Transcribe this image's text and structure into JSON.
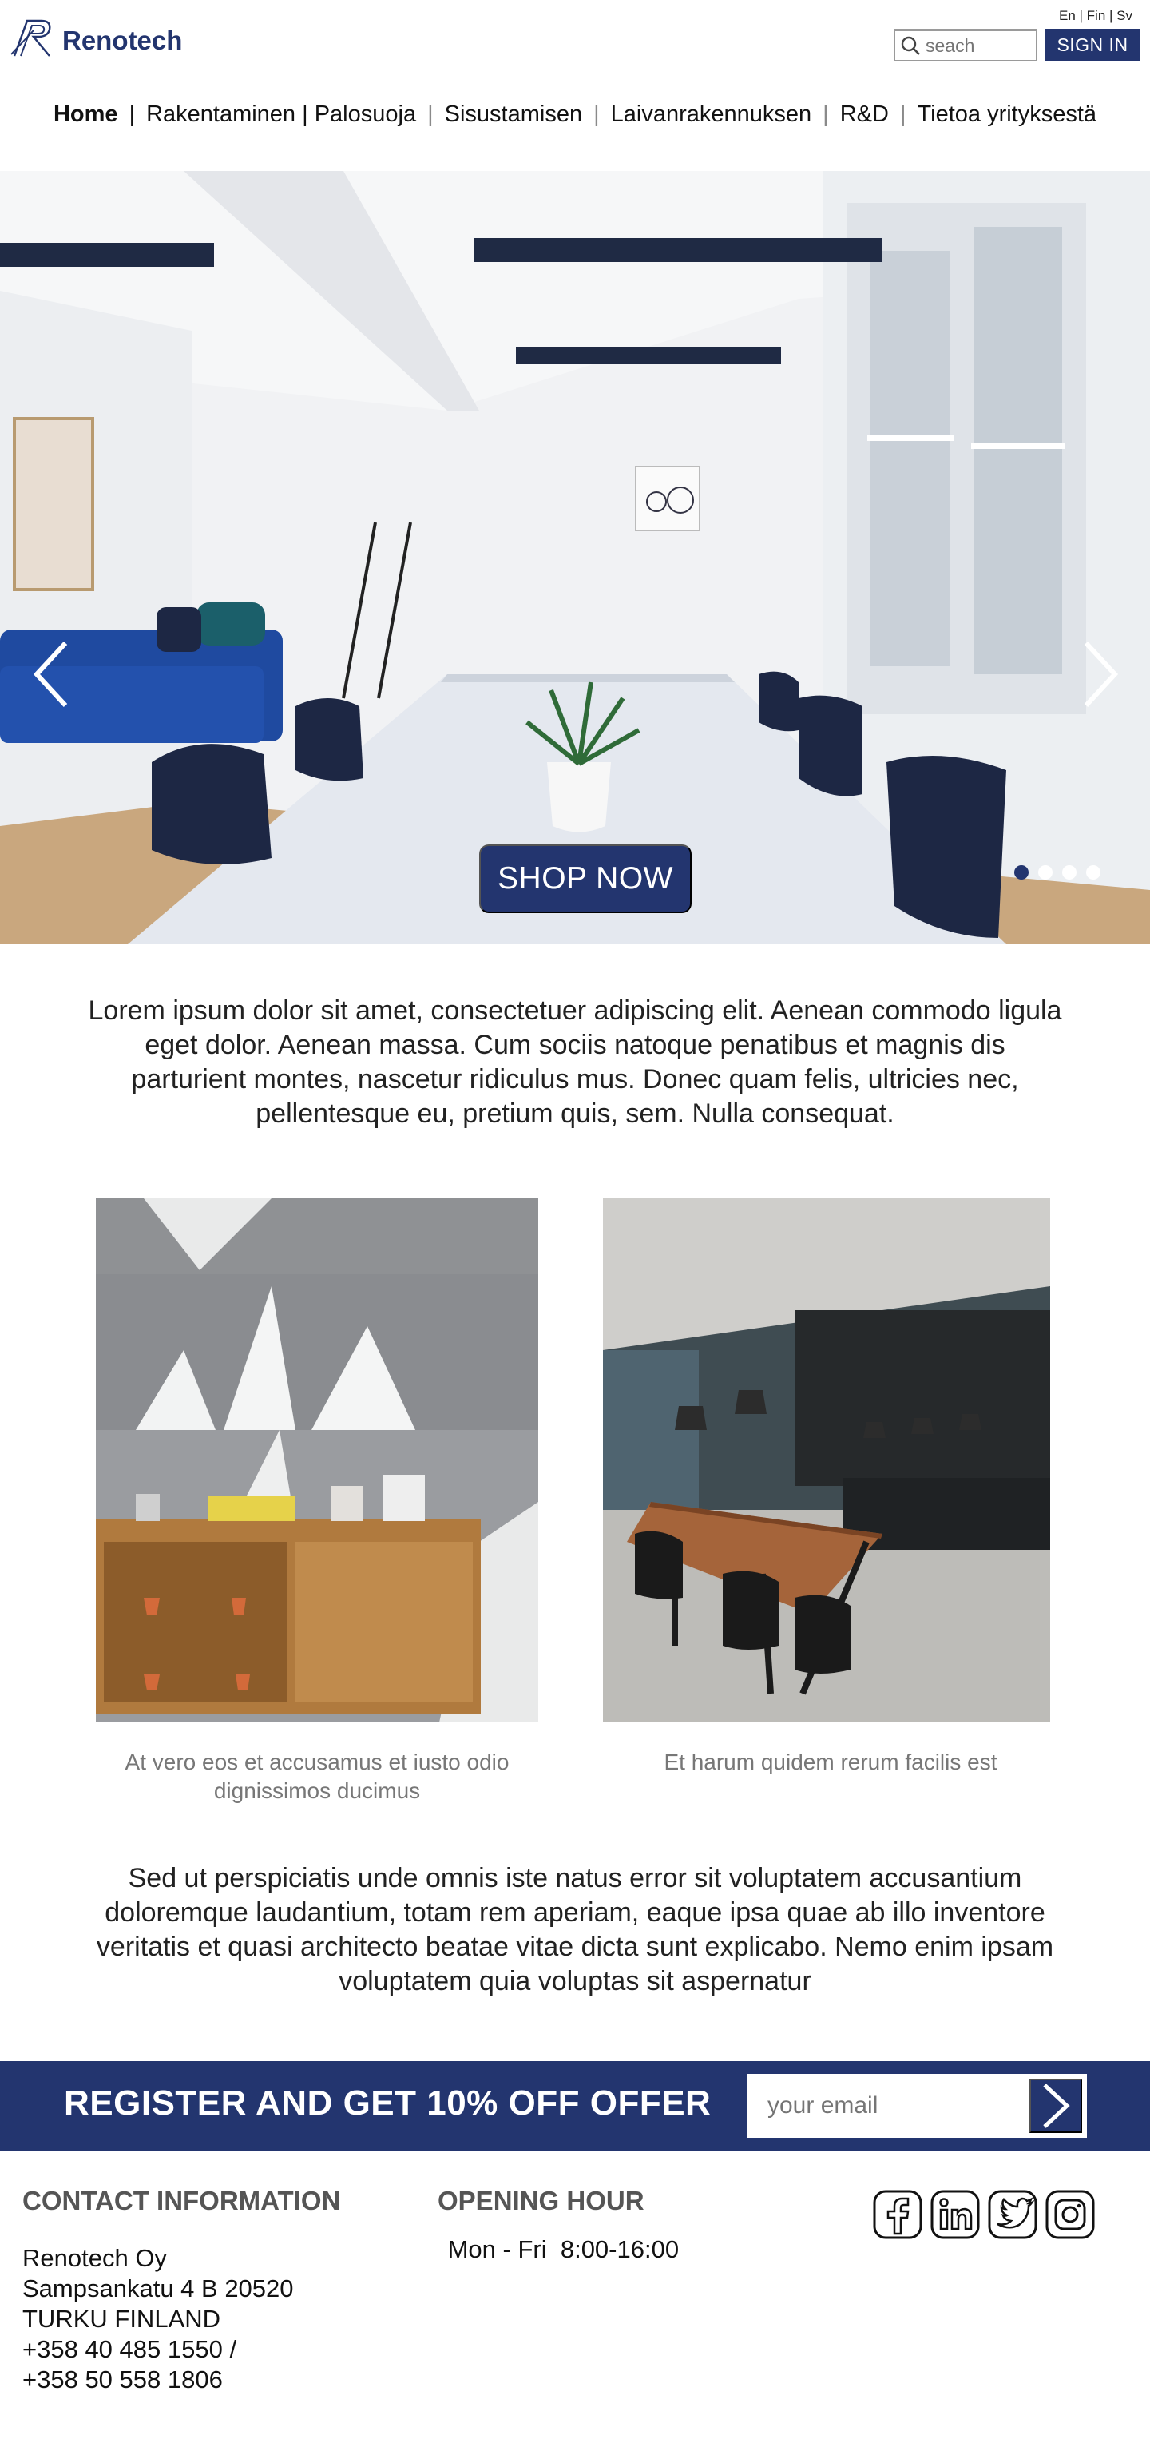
{
  "header": {
    "logo_text": "Renotech",
    "languages": "En | Fin | Sv",
    "search_placeholder": "seach",
    "signin_label": "SIGN IN"
  },
  "nav": [
    "Home",
    "|",
    "Rakentaminen | Palosuoja",
    "|",
    "Sisustamisen",
    "|",
    "Laivanrakennuksen",
    "|",
    "R&D",
    "|",
    "Tietoa yrityksestä"
  ],
  "hero": {
    "cta_label": "SHOP NOW",
    "slide_count": 4,
    "active_slide": 1
  },
  "intro_text": "Lorem ipsum dolor sit amet, consectetuer adipiscing elit. Aenean commodo ligula eget dolor. Aenean massa. Cum sociis natoque penatibus et magnis dis parturient montes, nascetur ridiculus mus. Donec quam felis, ultricies nec, pellentesque eu, pretium quis, sem. Nulla consequat.",
  "cards": [
    {
      "caption": "At vero eos et accusamus et iusto odio dignissimos ducimus"
    },
    {
      "caption": "Et harum quidem rerum facilis est"
    }
  ],
  "second_text": "Sed ut perspiciatis unde omnis iste natus error sit voluptatem accusantium doloremque laudantium, totam rem aperiam, eaque ipsa quae ab illo inventore veritatis et quasi architecto beatae vitae dicta sunt explicabo. Nemo enim ipsam voluptatem quia voluptas sit aspernatur",
  "register": {
    "title": "REGISTER AND GET 10% OFF OFFER",
    "email_placeholder": "your email"
  },
  "footer": {
    "contact_heading": "CONTACT INFORMATION",
    "company": "Renotech Oy",
    "address": "Sampsankatu 4 B 20520",
    "city": "TURKU FINLAND",
    "phone1": "+358 40 485 1550 /",
    "phone2": "+358 50 558 1806",
    "hours_heading": "OPENING HOUR",
    "hours": " Mon - Fri  8:00-16:00",
    "socials": [
      "facebook-icon",
      "linkedin-icon",
      "twitter-icon",
      "instagram-icon"
    ]
  },
  "colors": {
    "brand": "#23356f",
    "nav_separator": "#8a8a8a"
  }
}
